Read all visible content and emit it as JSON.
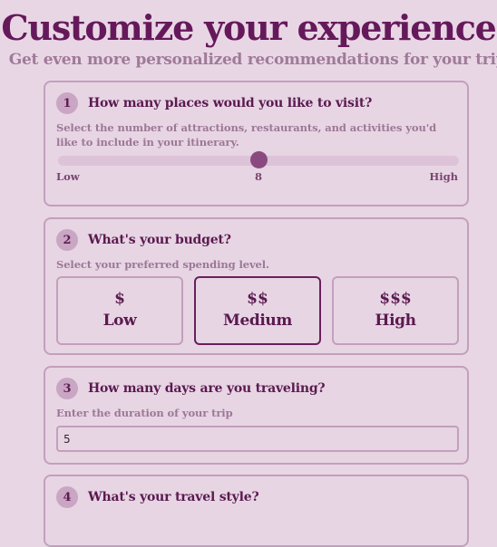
{
  "header": {
    "title": "Customize your experience",
    "subtitle": "Get even more personalized recommendations for your trip"
  },
  "questions": {
    "places": {
      "number": "1",
      "title": "How many places would you like to visit?",
      "description": "Select the number of attractions, restaurants, and activities you'd like to include in your itinerary.",
      "low_label": "Low",
      "high_label": "High",
      "value": "8",
      "slider_fraction": 0.5
    },
    "budget": {
      "number": "2",
      "title": "What's your budget?",
      "description": "Select your preferred spending level.",
      "options": [
        {
          "symbol": "$",
          "label": "Low"
        },
        {
          "symbol": "$$",
          "label": "Medium"
        },
        {
          "symbol": "$$$",
          "label": "High"
        }
      ],
      "selected": "Medium"
    },
    "days": {
      "number": "3",
      "title": "How many days are you traveling?",
      "description": "Enter the duration of your trip",
      "value": "5"
    },
    "style": {
      "number": "4",
      "title": "What's your travel style?"
    }
  },
  "colors": {
    "background": "#e8d6e5",
    "accent": "#65195a",
    "slider_thumb": "#8a4a80"
  }
}
